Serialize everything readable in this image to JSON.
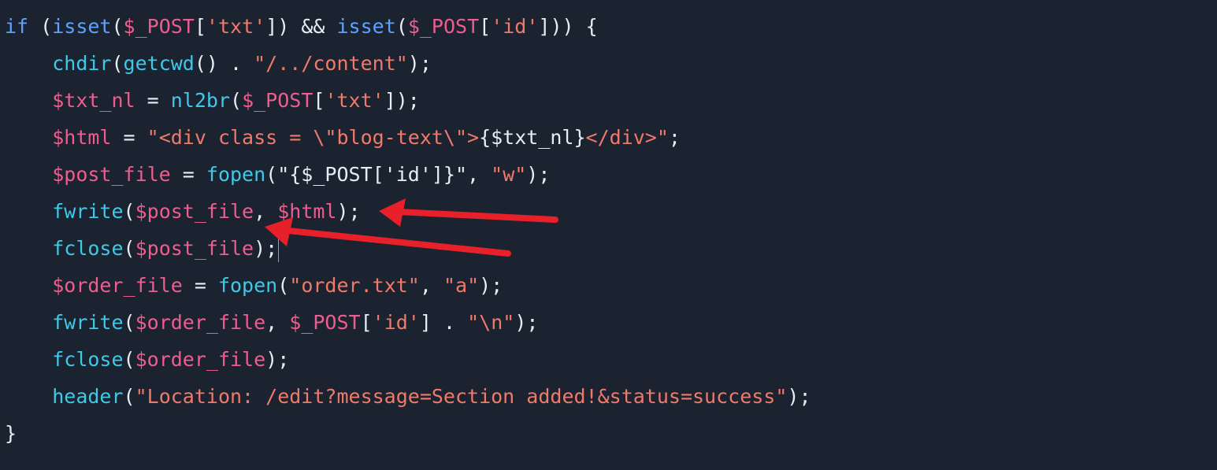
{
  "code": {
    "lines": [
      [
        [
          "kw",
          "if"
        ],
        [
          "plain",
          " ("
        ],
        [
          "kw",
          "isset"
        ],
        [
          "plain",
          "("
        ],
        [
          "var",
          "$_POST"
        ],
        [
          "plain",
          "["
        ],
        [
          "str",
          "'txt'"
        ],
        [
          "plain",
          "]) && "
        ],
        [
          "kw",
          "isset"
        ],
        [
          "plain",
          "("
        ],
        [
          "var",
          "$_POST"
        ],
        [
          "plain",
          "["
        ],
        [
          "str",
          "'id'"
        ],
        [
          "plain",
          "])) {"
        ]
      ],
      [
        [
          "plain",
          "    "
        ],
        [
          "fn",
          "chdir"
        ],
        [
          "plain",
          "("
        ],
        [
          "fn",
          "getcwd"
        ],
        [
          "plain",
          "() . "
        ],
        [
          "str",
          "\"/../content\""
        ],
        [
          "plain",
          ");"
        ]
      ],
      [
        [
          "plain",
          "    "
        ],
        [
          "var",
          "$txt_nl"
        ],
        [
          "plain",
          " = "
        ],
        [
          "fn",
          "nl2br"
        ],
        [
          "plain",
          "("
        ],
        [
          "var",
          "$_POST"
        ],
        [
          "plain",
          "["
        ],
        [
          "str",
          "'txt'"
        ],
        [
          "plain",
          "]);"
        ]
      ],
      [
        [
          "plain",
          "    "
        ],
        [
          "var",
          "$html"
        ],
        [
          "plain",
          " = "
        ],
        [
          "str",
          "\"<div class = \\\"blog-text\\\">"
        ],
        [
          "plain",
          "{$txt_nl}"
        ],
        [
          "str",
          "</div>\""
        ],
        [
          "plain",
          ";"
        ]
      ],
      [
        [
          "plain",
          "    "
        ],
        [
          "var",
          "$post_file"
        ],
        [
          "plain",
          " = "
        ],
        [
          "fn",
          "fopen"
        ],
        [
          "plain",
          "(\"{$_POST['id']}\", "
        ],
        [
          "str",
          "\"w\""
        ],
        [
          "plain",
          ");"
        ]
      ],
      [
        [
          "plain",
          "    "
        ],
        [
          "fn",
          "fwrite"
        ],
        [
          "plain",
          "("
        ],
        [
          "var",
          "$post_file"
        ],
        [
          "plain",
          ", "
        ],
        [
          "var",
          "$html"
        ],
        [
          "plain",
          ");"
        ]
      ],
      [
        [
          "plain",
          "    "
        ],
        [
          "fn",
          "fclose"
        ],
        [
          "plain",
          "("
        ],
        [
          "var",
          "$post_file"
        ],
        [
          "plain",
          ");"
        ]
      ],
      [
        [
          "plain",
          "    "
        ],
        [
          "var",
          "$order_file"
        ],
        [
          "plain",
          " = "
        ],
        [
          "fn",
          "fopen"
        ],
        [
          "plain",
          "("
        ],
        [
          "str",
          "\"order.txt\""
        ],
        [
          "plain",
          ", "
        ],
        [
          "str",
          "\"a\""
        ],
        [
          "plain",
          ");"
        ]
      ],
      [
        [
          "plain",
          "    "
        ],
        [
          "fn",
          "fwrite"
        ],
        [
          "plain",
          "("
        ],
        [
          "var",
          "$order_file"
        ],
        [
          "plain",
          ", "
        ],
        [
          "var",
          "$_POST"
        ],
        [
          "plain",
          "["
        ],
        [
          "str",
          "'id'"
        ],
        [
          "plain",
          "] . "
        ],
        [
          "str",
          "\"\\n\""
        ],
        [
          "plain",
          ");"
        ]
      ],
      [
        [
          "plain",
          "    "
        ],
        [
          "fn",
          "fclose"
        ],
        [
          "plain",
          "("
        ],
        [
          "var",
          "$order_file"
        ],
        [
          "plain",
          ");"
        ]
      ],
      [
        [
          "plain",
          "    "
        ],
        [
          "fn",
          "header"
        ],
        [
          "plain",
          "("
        ],
        [
          "str",
          "\"Location: /edit?message=Section added!&status=success\""
        ],
        [
          "plain",
          ");"
        ]
      ],
      [
        [
          "plain",
          "}"
        ]
      ]
    ]
  },
  "caret_line_index": 6,
  "colors": {
    "background": "#1b2230",
    "keyword": "#5aa3ff",
    "function": "#3fc9e8",
    "variable": "#ef5d8e",
    "string": "#f07a6a",
    "plain": "#e6edf3",
    "annotation_arrow": "#e8202a"
  },
  "annotations": [
    {
      "name": "red-arrow",
      "points_to": "fwrite line closing ');'"
    },
    {
      "name": "red-arrow",
      "points_to": "$post_file argument of fwrite"
    }
  ]
}
